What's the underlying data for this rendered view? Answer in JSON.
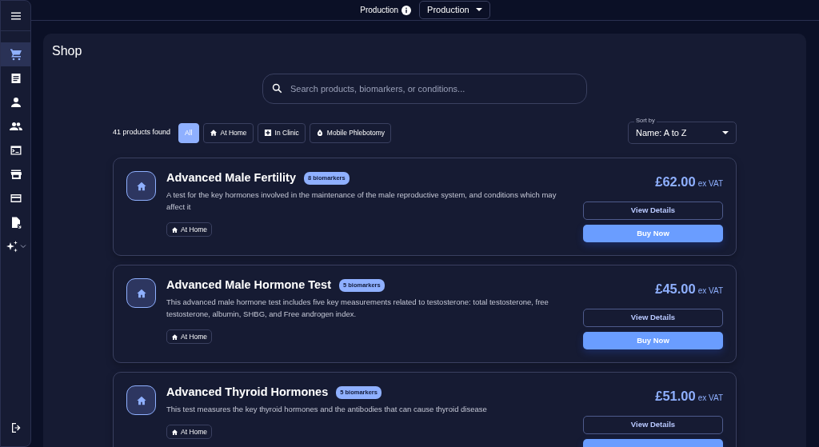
{
  "environment": {
    "label": "Production",
    "select_value": "Production"
  },
  "sidebar": {
    "items": [
      {
        "selected": true
      },
      {
        "selected": false
      },
      {
        "selected": false
      },
      {
        "selected": false
      },
      {
        "selected": false
      },
      {
        "selected": false
      },
      {
        "selected": false
      },
      {
        "selected": false
      },
      {
        "selected": false,
        "expanded": false
      }
    ]
  },
  "page_title": "Shop",
  "search": {
    "placeholder": "Search products, biomarkers, or conditions..."
  },
  "results_count": "41 products found",
  "filters": [
    {
      "label": "All",
      "selected": true
    },
    {
      "label": "At Home",
      "selected": false
    },
    {
      "label": "In Clinic",
      "selected": false
    },
    {
      "label": "Mobile Phlebotomy",
      "selected": false
    }
  ],
  "sort": {
    "label": "Sort by",
    "value": "Name: A to Z"
  },
  "products": [
    {
      "name": "Advanced Male Fertility",
      "badge": "8 biomarkers",
      "description": "A test for the key hormones involved in the maintenance of the male reproductive system, and conditions which may affect it",
      "tags": [
        "At Home"
      ],
      "price": "£62.00",
      "price_note": "ex VAT",
      "details_button": "View Details",
      "buy_button": "Buy Now"
    },
    {
      "name": "Advanced Male Hormone Test",
      "badge": "5 biomarkers",
      "description": "This advanced male hormone test includes five key measurements related to testosterone: total testosterone, free testosterone, albumin, SHBG, and Free androgen index.",
      "tags": [
        "At Home"
      ],
      "price": "£45.00",
      "price_note": "ex VAT",
      "details_button": "View Details",
      "buy_button": "Buy Now"
    },
    {
      "name": "Advanced Thyroid Hormones",
      "badge": "5 biomarkers",
      "description": "This test measures the key thyroid hormones and the antibodies that can cause thyroid disease",
      "tags": [
        "At Home"
      ],
      "price": "£51.00",
      "price_note": "ex VAT",
      "details_button": "View Details"
    }
  ]
}
